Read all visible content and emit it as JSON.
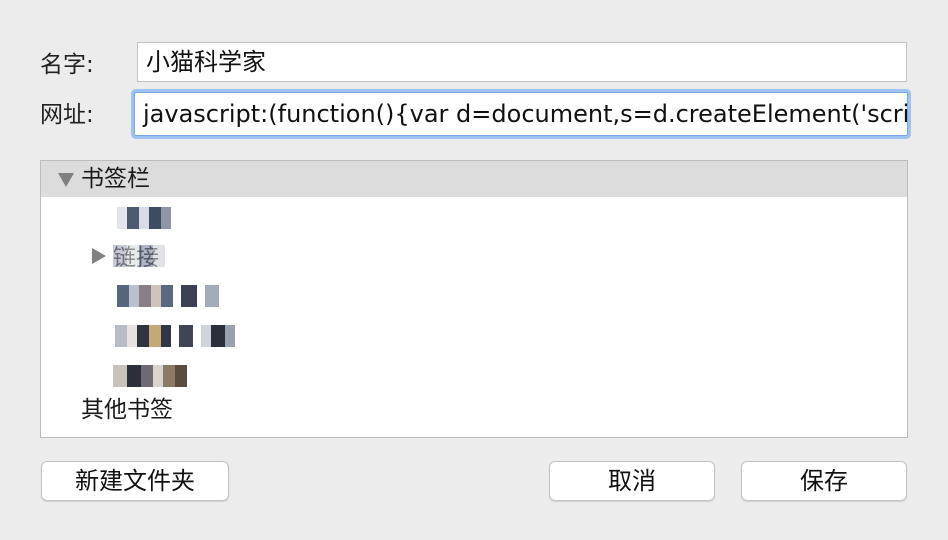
{
  "form": {
    "name_label": "名字:",
    "name_value": "小猫科学家",
    "url_label": "网址:",
    "url_value": "javascript:(function(){var d=document,s=d.createElement('script');"
  },
  "tree": {
    "root_label": "书签栏",
    "root_state": "expanded",
    "items": [
      {
        "label": "",
        "redacted": true
      },
      {
        "label": "链接",
        "redacted": true,
        "has_children": true,
        "state": "collapsed"
      },
      {
        "label": "",
        "redacted": true
      },
      {
        "label": "",
        "redacted": true
      },
      {
        "label": "",
        "redacted": true
      }
    ],
    "other_label": "其他书签"
  },
  "buttons": {
    "new_folder": "新建文件夹",
    "cancel": "取消",
    "save": "保存"
  },
  "colors": {
    "window_bg": "#ececec",
    "focus_ring": "#9ec2f2",
    "selected_row": "#dcdcdc"
  }
}
